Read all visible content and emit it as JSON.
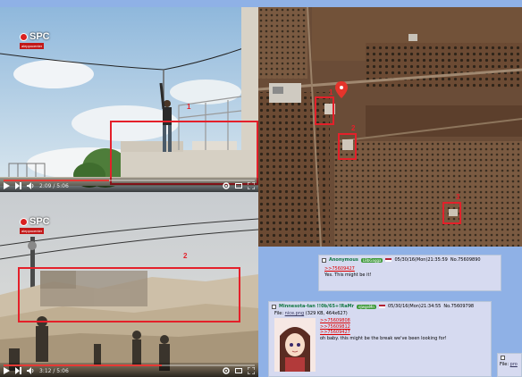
{
  "video_top": {
    "logo": "SPC",
    "logo_sub": "aleppocenter",
    "marker": "1",
    "time": "2:09 / 5:06",
    "progress": 0.42
  },
  "video_bottom": {
    "logo": "SPC",
    "logo_sub": "aleppocenter",
    "marker": "2",
    "time": "3:12 / 5:06",
    "progress": 0.63
  },
  "map": {
    "markers": [
      "1",
      "2",
      "3"
    ]
  },
  "post1": {
    "name": "Anonymous",
    "id": "LBbGagga",
    "datetime": "05/30/16(Mon)21:35:59",
    "number": "No.75609890",
    "body": "Yes. This might be it!"
  },
  "post2": {
    "name": "Minnesota-tan !!0b/65+!RaMr",
    "id": "eJwgeMn",
    "datetime": "05/30/16(Mon)21:34:55",
    "number": "No.75609798",
    "file_label": "File:",
    "file_link": "nice.png",
    "file_info": "(329 KB, 464x627)",
    "quotes": [
      ">>75609808",
      ">>75609812",
      ">>75609427"
    ],
    "body": "oh baby. this might be the break we've been looking for!"
  },
  "post3": {
    "file_label": "File:",
    "file_link": "pro"
  }
}
